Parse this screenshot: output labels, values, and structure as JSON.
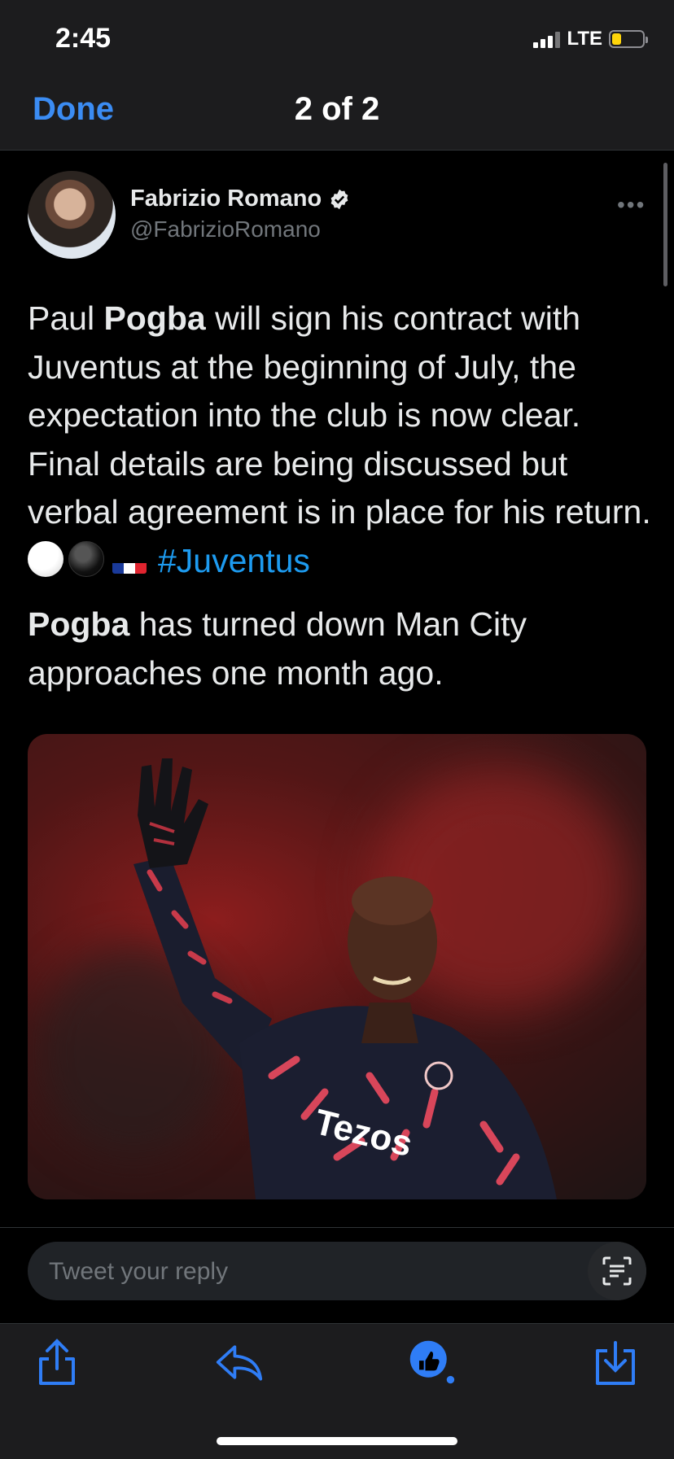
{
  "status_bar": {
    "time": "2:45",
    "network": "LTE",
    "battery_level": 0.3
  },
  "nav": {
    "done_label": "Done",
    "pager": "2 of 2"
  },
  "tweet": {
    "author_name": "Fabrizio Romano",
    "author_handle": "@FabrizioRomano",
    "paragraph1": {
      "t1": "Paul ",
      "b1": "Pogba",
      "t2": " will sign his contract with Juventus at the beginning of July, the expectation into the club is now clear. Final details are being discussed but verbal agreement is in place for his return. ",
      "hashtag": "#Juventus"
    },
    "paragraph2": {
      "b1": "Pogba",
      "t1": " has turned down Man City approaches one month ago."
    }
  },
  "reply": {
    "placeholder": "Tweet your reply"
  },
  "colors": {
    "link": "#1d9bf0",
    "done": "#3b8cf3",
    "battery": "#ffd60a",
    "toolbar_icons": "#2f7df6"
  },
  "icons": {
    "toolbar": [
      "share-icon",
      "reply-icon",
      "like-icon",
      "download-icon"
    ],
    "other": [
      "verified-badge-icon",
      "more-options-icon",
      "scan-text-icon"
    ]
  }
}
